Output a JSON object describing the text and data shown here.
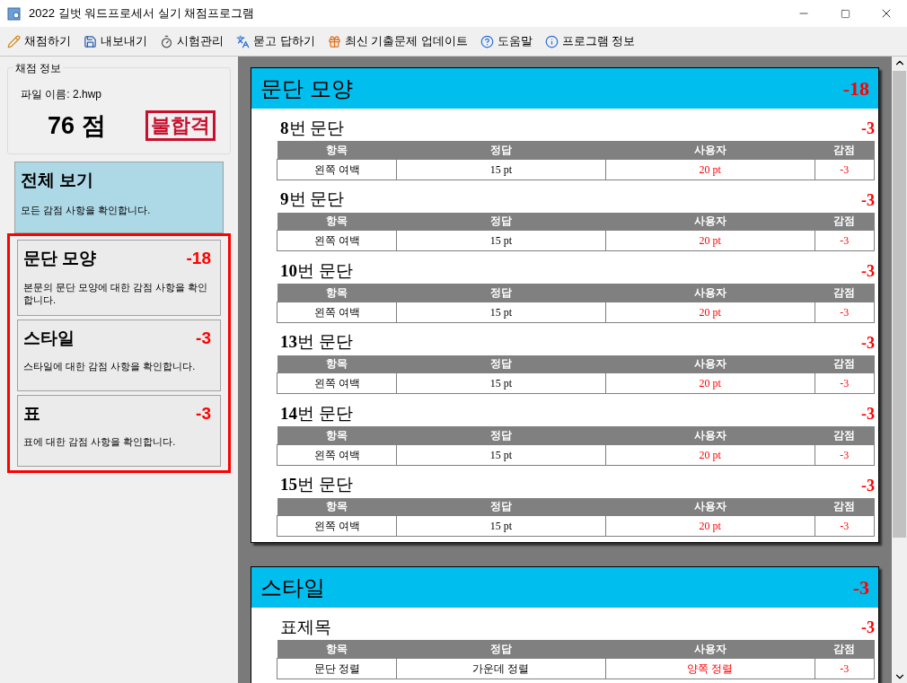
{
  "window": {
    "title": "2022 길벗 워드프로세서 실기 채점프로그램"
  },
  "toolbar": [
    {
      "kind": "grade",
      "label": "채점하기"
    },
    {
      "kind": "export",
      "label": "내보내기"
    },
    {
      "kind": "exam",
      "label": "시험관리"
    },
    {
      "kind": "qa",
      "label": "묻고 답하기"
    },
    {
      "kind": "update",
      "label": "최신 기출문제 업데이트"
    },
    {
      "kind": "help",
      "label": "도움말"
    },
    {
      "kind": "info",
      "label": "프로그램 정보"
    }
  ],
  "score_info": {
    "legend": "채점 정보",
    "file_name": "파일 이름: 2.hwp",
    "score": "76 점",
    "result_stamp": "불합격"
  },
  "overview": {
    "title": "전체 보기",
    "description": "모든 감점 사항을 확인합니다.",
    "selected": true
  },
  "highlight_box": {
    "shown": true
  },
  "categories": [
    {
      "title": "문단 모양",
      "deduction": "-18",
      "description": "본문의 문단 모양에 대한 감점 사항을 확인합니다.",
      "selected": false
    },
    {
      "title": "스타일",
      "deduction": "-3",
      "description": "스타일에 대한 감점 사항을 확인합니다.",
      "selected": false
    },
    {
      "title": "표",
      "deduction": "-3",
      "description": "표에 대한 감점 사항을 확인합니다.",
      "selected": false
    }
  ],
  "sections": [
    {
      "title": "문단 모양",
      "deduction": "-18",
      "items": [
        {
          "title": "**8**번 문단",
          "deduction": "-3",
          "columns": [
            "항목",
            "정답",
            "사용자",
            "감점"
          ],
          "rows": [
            [
              "왼쪽 여백",
              "15 pt",
              "20 pt",
              "-3"
            ]
          ]
        },
        {
          "title": "**9**번 문단",
          "deduction": "-3",
          "columns": [
            "항목",
            "정답",
            "사용자",
            "감점"
          ],
          "rows": [
            [
              "왼쪽 여백",
              "15 pt",
              "20 pt",
              "-3"
            ]
          ]
        },
        {
          "title": "**10**번 문단",
          "deduction": "-3",
          "columns": [
            "항목",
            "정답",
            "사용자",
            "감점"
          ],
          "rows": [
            [
              "왼쪽 여백",
              "15 pt",
              "20 pt",
              "-3"
            ]
          ]
        },
        {
          "title": "**13**번 문단",
          "deduction": "-3",
          "columns": [
            "항목",
            "정답",
            "사용자",
            "감점"
          ],
          "rows": [
            [
              "왼쪽 여백",
              "15 pt",
              "20 pt",
              "-3"
            ]
          ]
        },
        {
          "title": "**14**번 문단",
          "deduction": "-3",
          "columns": [
            "항목",
            "정답",
            "사용자",
            "감점"
          ],
          "rows": [
            [
              "왼쪽 여백",
              "15 pt",
              "20 pt",
              "-3"
            ]
          ]
        },
        {
          "title": "**15**번 문단",
          "deduction": "-3",
          "columns": [
            "항목",
            "정답",
            "사용자",
            "감점"
          ],
          "rows": [
            [
              "왼쪽 여백",
              "15 pt",
              "20 pt",
              "-3"
            ]
          ]
        }
      ]
    },
    {
      "title": "스타일",
      "deduction": "-3",
      "items": [
        {
          "title": "표제목",
          "deduction": "-3",
          "columns": [
            "항목",
            "정답",
            "사용자",
            "감점"
          ],
          "rows": [
            [
              "문단 정렬",
              "가운데 정렬",
              "양쪽 정렬",
              "-3"
            ]
          ]
        }
      ]
    }
  ]
}
